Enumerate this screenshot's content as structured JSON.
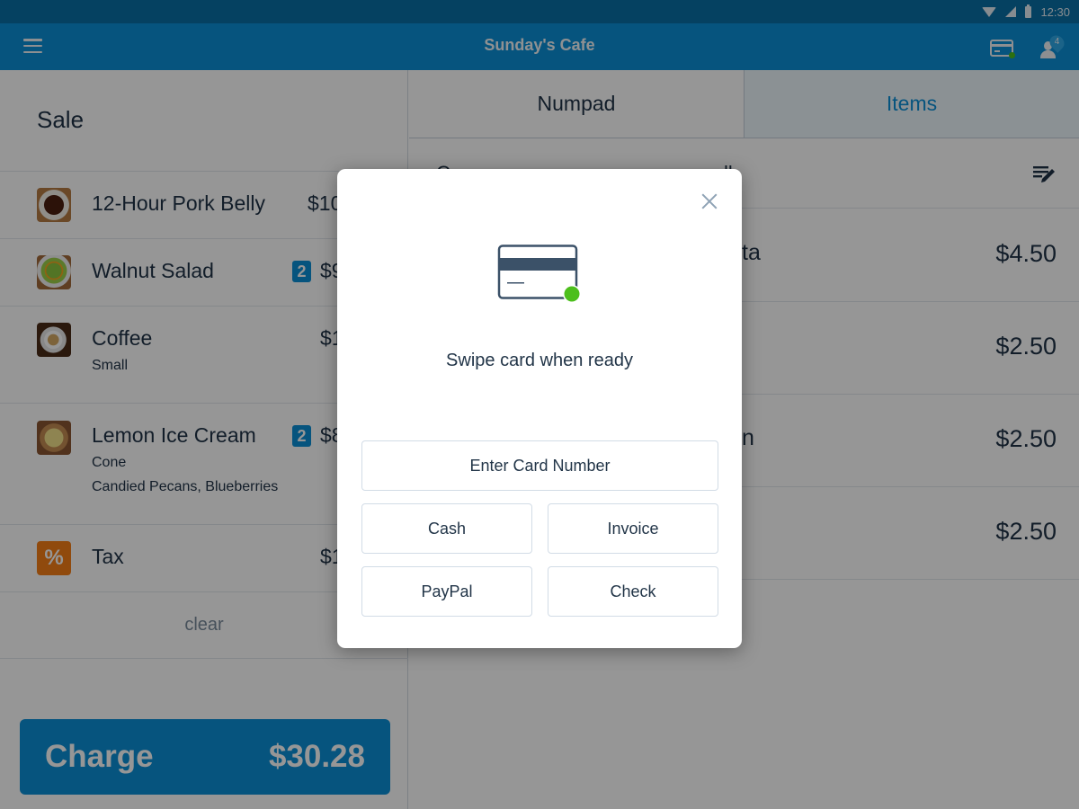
{
  "status_bar": {
    "time": "12:30",
    "icons": [
      "wifi-icon",
      "signal-icon",
      "battery-icon"
    ]
  },
  "app_bar": {
    "title": "Sunday's Cafe",
    "menu_icon": "hamburger-icon",
    "card_reader_icon": "card-reader-icon",
    "card_reader_status_color": "#4cbf1c",
    "user_icon": "user-icon",
    "user_badge_count": "4"
  },
  "sale": {
    "title": "Sale",
    "items": [
      {
        "name": "12-Hour Pork Belly",
        "price_visible": "$10",
        "qty": "",
        "modifiers": []
      },
      {
        "name": "Walnut Salad",
        "price_visible": "$9",
        "qty": "2",
        "modifiers": []
      },
      {
        "name": "Coffee",
        "price_visible": "$1",
        "qty": "",
        "modifiers": [
          "Small"
        ]
      },
      {
        "name": "Lemon Ice Cream",
        "price_visible": "$8",
        "qty": "2",
        "modifiers": [
          "Cone",
          "Candied Pecans, Blueberries"
        ]
      },
      {
        "name": "Tax",
        "price_visible": "$1",
        "qty": "",
        "modifiers": [],
        "icon": "%"
      }
    ],
    "clear_label": "clear",
    "charge": {
      "label": "Charge",
      "amount": "$30.28"
    }
  },
  "catalog": {
    "tabs": [
      {
        "label": "Numpad",
        "active": false
      },
      {
        "label": "Items",
        "active": true
      }
    ],
    "category_partial_left": "C",
    "category_partial_right": "ll",
    "edit_icon": "edit-list-icon",
    "rows": [
      {
        "name_visible": "ta",
        "price": "$4.50"
      },
      {
        "name_visible": "",
        "price": "$2.50"
      },
      {
        "name_visible": "n",
        "price": "$2.50"
      },
      {
        "name_visible": "",
        "price": "$2.50"
      }
    ]
  },
  "payment_modal": {
    "close_icon": "close-icon",
    "card_icon": "credit-card-icon",
    "card_icon_status_color": "#4cbf1c",
    "prompt": "Swipe card when ready",
    "buttons": {
      "enter_card": "Enter Card Number",
      "cash": "Cash",
      "invoice": "Invoice",
      "paypal": "PayPal",
      "check": "Check"
    }
  },
  "colors": {
    "brand_blue": "#0b8fd6",
    "status_bar": "#0a6fa6",
    "text_dark": "#1f3246",
    "tax_orange": "#f57f17",
    "ready_green": "#4cbf1c"
  }
}
